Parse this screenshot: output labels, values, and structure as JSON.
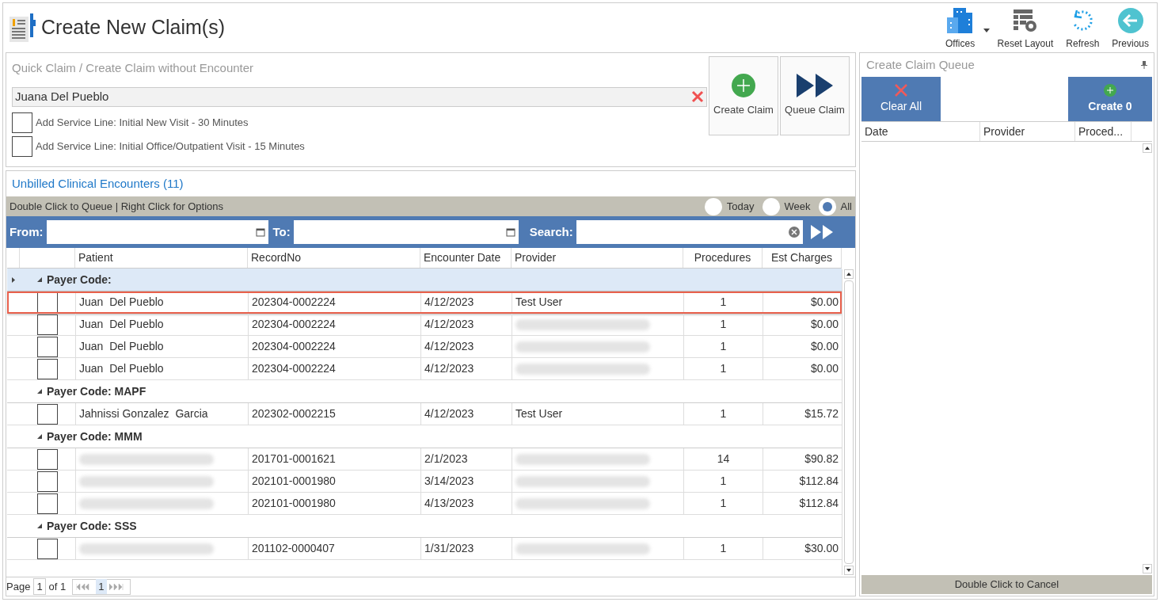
{
  "header": {
    "title": "Create New Claim(s)",
    "toolbar": [
      {
        "kind": "offices",
        "label": "Offices"
      },
      {
        "kind": "reset",
        "label": "Reset Layout"
      },
      {
        "kind": "refresh",
        "label": "Refresh"
      },
      {
        "kind": "previous",
        "label": "Previous"
      }
    ]
  },
  "quick_claim": {
    "title": "Quick Claim / Create Claim without Encounter",
    "patient": "Juana Del Pueblo",
    "service_lines": [
      {
        "label": "Add Service Line: Initial New Visit - 30 Minutes",
        "checked": false
      },
      {
        "label": "Add Service Line: Initial Office/Outpatient Visit - 15 Minutes",
        "checked": false
      }
    ],
    "buttons": [
      {
        "kind": "create",
        "label": "Create Claim"
      },
      {
        "kind": "queue",
        "label": "Queue Claim"
      }
    ]
  },
  "encounters": {
    "title": "Unbilled Clinical Encounters (11)",
    "hint": "Double Click to Queue | Right Click for Options",
    "ranges": [
      {
        "label": "Today",
        "selected": false
      },
      {
        "label": "Week",
        "selected": false
      },
      {
        "label": "All",
        "selected": true
      }
    ],
    "filters": {
      "from": "From:",
      "to": "To:",
      "search": "Search:"
    },
    "columns": [
      "Patient",
      "RecordNo",
      "Encounter Date",
      "Provider",
      "Procedures",
      "Est Charges"
    ],
    "groups": [
      {
        "label": "Payer Code:",
        "rows": [
          {
            "patient": "Juan  Del Pueblo",
            "record": "202304-0002224",
            "date": "4/12/2023",
            "provider": "Test User",
            "procedures": "1",
            "charges": "$0.00",
            "selected": true,
            "checked": false
          },
          {
            "patient": "Juan  Del Pueblo",
            "record": "202304-0002224",
            "date": "4/12/2023",
            "provider_redacted": true,
            "procedures": "1",
            "charges": "$0.00",
            "selected": false,
            "checked": false
          },
          {
            "patient": "Juan  Del Pueblo",
            "record": "202304-0002224",
            "date": "4/12/2023",
            "provider_redacted": true,
            "procedures": "1",
            "charges": "$0.00",
            "selected": false,
            "checked": false
          },
          {
            "patient": "Juan  Del Pueblo",
            "record": "202304-0002224",
            "date": "4/12/2023",
            "provider_redacted": true,
            "procedures": "1",
            "charges": "$0.00",
            "selected": false,
            "checked": false
          }
        ]
      },
      {
        "label": "Payer Code: MAPF",
        "rows": [
          {
            "patient": "Jahnissi Gonzalez  Garcia",
            "record": "202302-0002215",
            "date": "4/12/2023",
            "provider": "Test User",
            "procedures": "1",
            "charges": "$15.72",
            "selected": false,
            "checked": false
          }
        ]
      },
      {
        "label": "Payer Code: MMM",
        "rows": [
          {
            "patient_redacted": true,
            "record": "201701-0001621",
            "date": "2/1/2023",
            "provider_redacted": true,
            "procedures": "14",
            "charges": "$90.82",
            "selected": false,
            "checked": false
          },
          {
            "patient_redacted": true,
            "record": "202101-0001980",
            "date": "3/14/2023",
            "provider_redacted": true,
            "procedures": "1",
            "charges": "$112.84",
            "selected": false,
            "checked": false
          },
          {
            "patient_redacted": true,
            "record": "202101-0001980",
            "date": "4/13/2023",
            "provider_redacted": true,
            "procedures": "1",
            "charges": "$112.84",
            "selected": false,
            "checked": false
          }
        ]
      },
      {
        "label": "Payer Code: SSS",
        "rows": [
          {
            "patient_redacted": true,
            "record": "201102-0000407",
            "date": "1/31/2023",
            "provider_redacted": true,
            "procedures": "1",
            "charges": "$30.00",
            "selected": false,
            "checked": false
          }
        ]
      }
    ],
    "pager": {
      "page_label": "Page",
      "page": "1",
      "of": "of 1",
      "current": "1"
    }
  },
  "queue": {
    "title": "Create Claim Queue",
    "clear": "Clear All",
    "create": "Create 0",
    "columns": [
      "Date",
      "Provider",
      "Proced..."
    ],
    "footer": "Double Click to Cancel"
  }
}
